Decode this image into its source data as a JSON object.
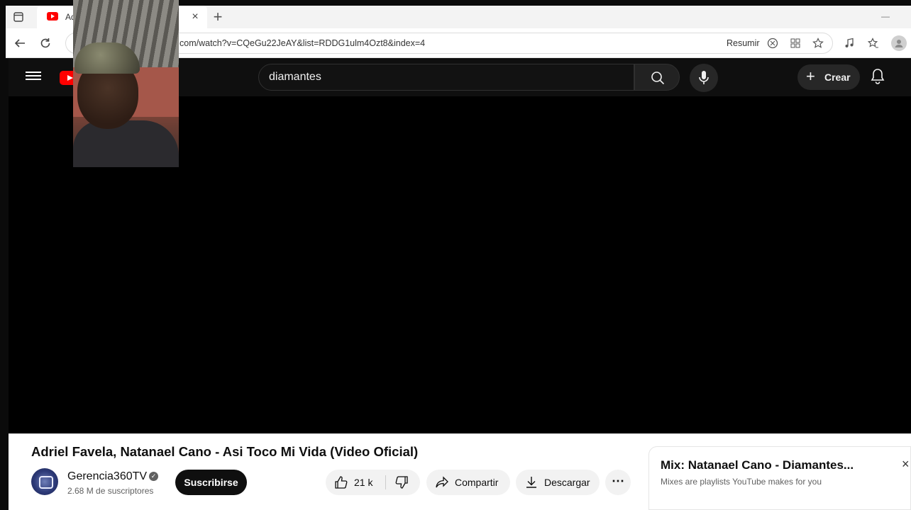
{
  "browser": {
    "tab_title": "Adr",
    "tab_close": "×",
    "new_tab": "+",
    "minimize": "—",
    "url": "com/watch?v=CQeGu22JeAY&list=RDDG1ulm4Ozt8&index=4",
    "summarize_label": "Resumir"
  },
  "youtube": {
    "search_value": "diamantes",
    "create_plus": "+",
    "create_label": "Crear"
  },
  "video": {
    "title": "Adriel Favela, Natanael Cano - Asi Toco Mi Vida (Video Oficial)",
    "channel_name": "Gerencia360TV",
    "verified_mark": "✓",
    "subscribers": "2.68 M de suscriptores",
    "subscribe_label": "Suscribirse",
    "likes": "21 k",
    "share_label": "Compartir",
    "download_label": "Descargar",
    "more_label": "⋯"
  },
  "mix": {
    "title": "Mix: Natanael Cano - Diamantes...",
    "subtitle": "Mixes are playlists YouTube makes for you",
    "close": "×"
  },
  "colors": {
    "youtube_red": "#ff0000",
    "header_bg": "#0f0f0f",
    "subscribe_bg": "#0f0f0f"
  }
}
